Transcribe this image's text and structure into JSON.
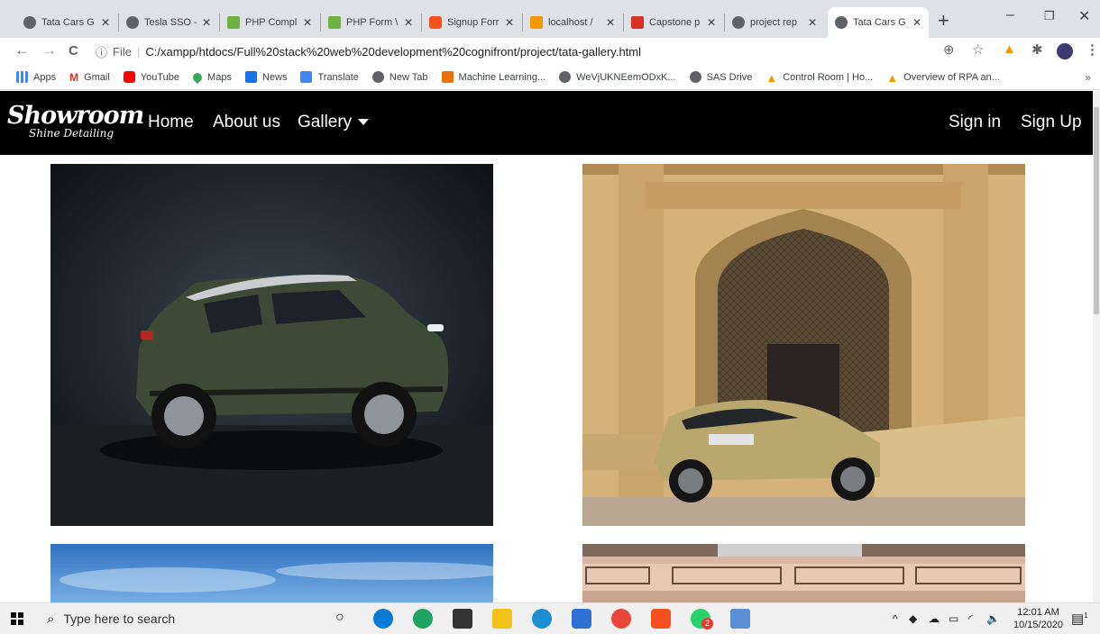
{
  "browser": {
    "tabs": [
      {
        "title": "Tata Cars G",
        "close": "✕"
      },
      {
        "title": "Tesla SSO -",
        "close": "✕"
      },
      {
        "title": "PHP Compl",
        "close": "✕"
      },
      {
        "title": "PHP Form \\",
        "close": "✕"
      },
      {
        "title": "Signup Forr",
        "close": "✕"
      },
      {
        "title": "localhost /",
        "close": "✕"
      },
      {
        "title": "Capstone p",
        "close": "✕"
      },
      {
        "title": "project rep",
        "close": "✕"
      },
      {
        "title": "Tata Cars G",
        "close": "✕"
      }
    ],
    "active_tab_index": 8,
    "new_tab": "+",
    "window_controls": [
      "–",
      "❐",
      "✕"
    ],
    "nav": {
      "back": "←",
      "forward": "→",
      "reload": "C"
    },
    "address": {
      "scheme_label": "File",
      "url": "C:/xampp/htdocs/Full%20stack%20web%20development%20cognifront/project/tata-gallery.html"
    },
    "bookmarks": [
      {
        "label": "Apps",
        "icon": "apps-grid-icon",
        "color": "#4285f4"
      },
      {
        "label": "Gmail",
        "icon": "gmail-icon",
        "color": "#d93025"
      },
      {
        "label": "YouTube",
        "icon": "youtube-icon",
        "color": "#ff0000"
      },
      {
        "label": "Maps",
        "icon": "maps-pin-icon",
        "color": "#34a853"
      },
      {
        "label": "News",
        "icon": "news-icon",
        "color": "#1a73e8"
      },
      {
        "label": "Translate",
        "icon": "translate-icon",
        "color": "#4285f4"
      },
      {
        "label": "New Tab",
        "icon": "globe-icon",
        "color": "#5f6368"
      },
      {
        "label": "Machine Learning...",
        "icon": "ml-icon",
        "color": "#e8710a"
      },
      {
        "label": "WeVjUKNEemODxK...",
        "icon": "globe-icon",
        "color": "#5f6368"
      },
      {
        "label": "SAS Drive",
        "icon": "globe-icon",
        "color": "#5f6368"
      },
      {
        "label": "Control Room | Ho...",
        "icon": "automation-icon",
        "color": "#f29900"
      },
      {
        "label": "Overview of RPA an...",
        "icon": "automation-icon",
        "color": "#f29900"
      }
    ],
    "bookmarks_more": "»"
  },
  "site": {
    "logo": {
      "line1": "Showroom",
      "line2": "Shine Detailing"
    },
    "nav": {
      "home": "Home",
      "about": "About us",
      "gallery": "Gallery",
      "signin": "Sign in",
      "signup": "Sign Up"
    }
  },
  "gallery": {
    "images": [
      {
        "name": "tata-nexon-green-suv",
        "colors": {
          "bg": "#1a1f24",
          "car": "#3d4a35"
        }
      },
      {
        "name": "tata-altroz-gold-hatchback",
        "colors": {
          "bg": "#d4b27a",
          "car": "#b9a86e"
        }
      },
      {
        "name": "sky-landscape",
        "colors": {
          "bg": "#4d8fd1"
        }
      },
      {
        "name": "building-facade",
        "colors": {
          "bg": "#d9b7a4"
        }
      }
    ]
  },
  "taskbar": {
    "search_placeholder": "Type here to search",
    "time": "12:01 AM",
    "date": "10/15/2020",
    "notification_count": "1",
    "whatsapp_badge": "2"
  }
}
